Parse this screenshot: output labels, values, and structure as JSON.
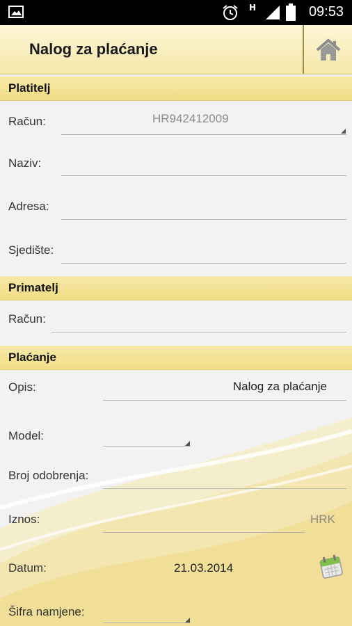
{
  "status_bar": {
    "time": "09:53",
    "network": "H"
  },
  "header": {
    "title": "Nalog za plaćanje"
  },
  "platitelj": {
    "section_title": "Platitelj",
    "racun_label": "Račun:",
    "racun_value": "HR942412009",
    "naziv_label": "Naziv:",
    "adresa_label": "Adresa:",
    "sjediste_label": "Sjedište:"
  },
  "primatelj": {
    "section_title": "Primatelj",
    "racun_label": "Račun:"
  },
  "placanje": {
    "section_title": "Plaćanje",
    "opis_label": "Opis:",
    "opis_value": "Nalog za plaćanje",
    "model_label": "Model:",
    "broj_label": "Broj odobrenja:",
    "iznos_label": "Iznos:",
    "iznos_currency": "HRK",
    "datum_label": "Datum:",
    "datum_value": "21.03.2014",
    "sifra_label": "Šifra namjene:"
  }
}
